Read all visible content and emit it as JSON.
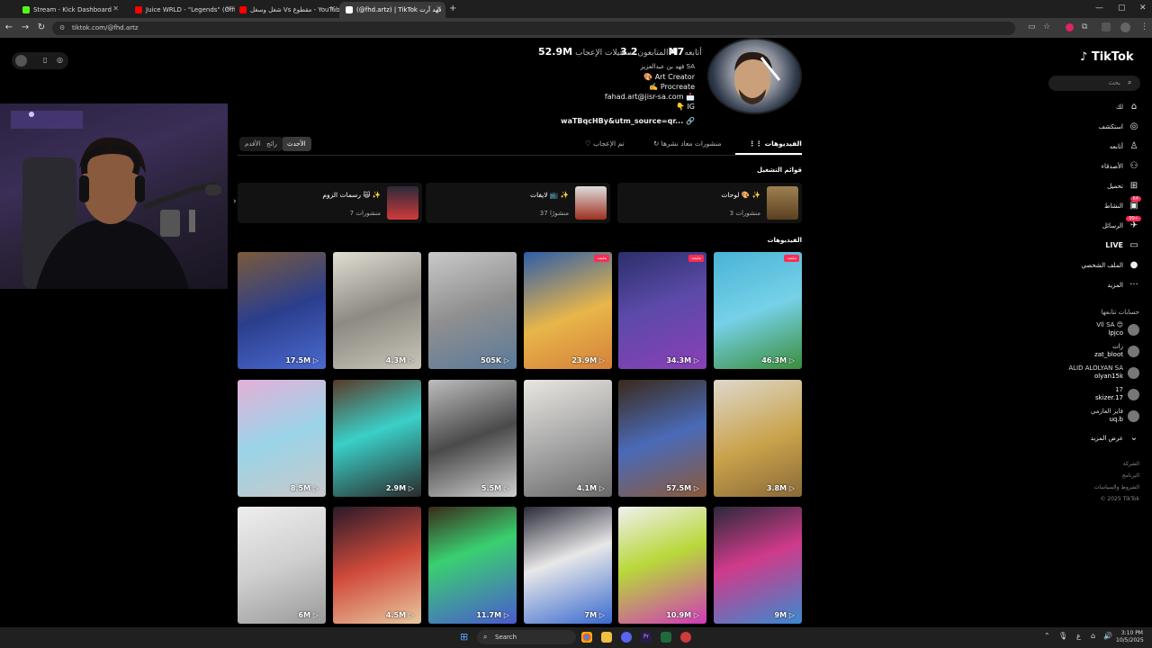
{
  "browser": {
    "tabs": [
      {
        "label": "Stream - Kick Dashboard",
        "color": "#53fc18"
      },
      {
        "label": "Juice WRLD - \"Legends\" (Offici...",
        "color": "#ff0000"
      },
      {
        "label": "شغل وسغل Vs مقطوع - YouTube",
        "color": "#ff0000"
      },
      {
        "label": "(@fhd.artz) | TikTok فهد آرت",
        "color": "#ffffff"
      }
    ],
    "url": "tiktok.com/@fhd.artz",
    "new_tab": "+"
  },
  "profile": {
    "stats": [
      {
        "label": "أتابعه",
        "value": "47"
      },
      {
        "label": "المتابعون",
        "value": "3.2M"
      },
      {
        "label": "تسجيلات الإعجاب",
        "value": "52.9M"
      }
    ],
    "bio": [
      "فهد بن عبدالعزيز SA",
      "🎨 Art Creator",
      "✍️ Procreate",
      "fahad.art@jisr-sa.com 📩",
      "👇 IG"
    ],
    "link": "waTBqcHBy&utm_source=qr..."
  },
  "sort": [
    {
      "label": "الأحدث",
      "active": true
    },
    {
      "label": "رائج",
      "active": false
    },
    {
      "label": "الأقدم",
      "active": false
    }
  ],
  "profile_tabs": [
    {
      "label": "الفيديوهات",
      "active": true
    },
    {
      "label": "منشورات معاد نشرها",
      "active": false
    },
    {
      "label": "تم الإعجاب",
      "active": false
    }
  ],
  "playlists_title": "قوائم التشغيل",
  "playlists": [
    {
      "title": "لوحات 🎨 ✨",
      "count": "3 منشورات"
    },
    {
      "title": "لايفات 📺 ✨",
      "count": "37 منشورًا"
    },
    {
      "title": "رسمات الزوم 🙀 ✨",
      "count": "7 منشورات"
    }
  ],
  "videos_title": "الفيديوهات",
  "pinned_label": "مثبت",
  "videos": [
    {
      "views": "46.3M",
      "pinned": true,
      "bg": "linear-gradient(160deg,#4ab3d6,#76d1e8 50%,#3a8e3a)"
    },
    {
      "views": "34.3M",
      "pinned": true,
      "bg": "linear-gradient(160deg,#2b2f6a,#5b4aa8 45%,#8a3fb8)"
    },
    {
      "views": "23.9M",
      "pinned": true,
      "bg": "linear-gradient(160deg,#2d5da8,#e8b64a 55%,#d4803a)"
    },
    {
      "views": "505K",
      "pinned": false,
      "bg": "linear-gradient(160deg,#c9c9c9,#8f8f8f 50%,#5a7a9a)"
    },
    {
      "views": "4.3M",
      "pinned": false,
      "bg": "linear-gradient(160deg,#e0ddd3,#8c8a82 50%,#c9c5b9)"
    },
    {
      "views": "17.5M",
      "pinned": false,
      "bg": "linear-gradient(160deg,#7a5a3a,#2b3e8c 50%,#4a6ad0)"
    },
    {
      "views": "3.8M",
      "pinned": false,
      "bg": "linear-gradient(160deg,#ddd8cc,#c9a24a 55%,#8a6a3a)"
    },
    {
      "views": "57.5M",
      "pinned": false,
      "bg": "linear-gradient(160deg,#3a2a1a,#4a6ab8 50%,#8a5a3a)"
    },
    {
      "views": "4.1M",
      "pinned": false,
      "bg": "linear-gradient(160deg,#e9e6e0,#aaa 50%,#6a6a6a)"
    },
    {
      "views": "5.5M",
      "pinned": false,
      "bg": "linear-gradient(160deg,#bdbdbd,#4a4a4a 50%,#cfcfcf)"
    },
    {
      "views": "2.9M",
      "pinned": false,
      "bg": "linear-gradient(160deg,#5a3a2a,#3ad0c8 45%,#2a2a2a)"
    },
    {
      "views": "8.5M",
      "pinned": false,
      "bg": "linear-gradient(160deg,#e4b0d8,#9ad4e8 50%,#c8c8c8)"
    },
    {
      "views": "9M",
      "pinned": false,
      "bg": "linear-gradient(160deg,#2a2a3a,#d03a8a 45%,#3a8ad0)"
    },
    {
      "views": "10.9M",
      "pinned": false,
      "bg": "linear-gradient(160deg,#f0f0f0,#b8d83a 45%,#d03ab8)"
    },
    {
      "views": "7M",
      "pinned": false,
      "bg": "linear-gradient(160deg,#2a2a3a,#e8e8e8 45%,#3a6ad0)"
    },
    {
      "views": "11.7M",
      "pinned": false,
      "bg": "linear-gradient(160deg,#3a2a1a,#3ad070 40%,#4a5ad0)"
    },
    {
      "views": "4.5M",
      "pinned": false,
      "bg": "linear-gradient(160deg,#2a1a2a,#d04a3a 50%,#e8c8a0)"
    },
    {
      "views": "6M",
      "pinned": false,
      "bg": "linear-gradient(160deg,#eeeeee,#cfcfcf 50%,#9a9a9a)"
    }
  ],
  "sidebar": {
    "logo": "TikTok",
    "search_placeholder": "بحث",
    "nav": [
      {
        "label": "لك",
        "icon": "home-icon",
        "glyph": "⌂"
      },
      {
        "label": "استكشف",
        "icon": "compass-icon",
        "glyph": "◎"
      },
      {
        "label": "أتابعه",
        "icon": "follow-icon",
        "glyph": "♙"
      },
      {
        "label": "الأصدقاء",
        "icon": "friends-icon",
        "glyph": "⚇"
      },
      {
        "label": "تحميل",
        "icon": "upload-icon",
        "glyph": "⊞"
      },
      {
        "label": "النشاط",
        "icon": "activity-icon",
        "glyph": "▣",
        "badge": "64"
      },
      {
        "label": "الرسائل",
        "icon": "messages-icon",
        "glyph": "✈",
        "badge": "99+"
      },
      {
        "label": "LIVE",
        "icon": "live-icon",
        "glyph": "▭"
      },
      {
        "label": "الملف الشخصي",
        "icon": "profile-icon",
        "glyph": "●"
      },
      {
        "label": "المزيد",
        "icon": "more-icon",
        "glyph": "···"
      }
    ],
    "following_title": "حسابات تتابعها",
    "following": [
      {
        "name": "Vll SA 😊",
        "handle": "lpjco"
      },
      {
        "name": "زات",
        "handle": "zat_bloot"
      },
      {
        "name": "ALID ALOLYAN SA",
        "handle": "olyan15k"
      },
      {
        "name": "17",
        "handle": "skizer.17"
      },
      {
        "name": "فايز العازمي",
        "handle": "uq.b"
      }
    ],
    "show_more": "عرض المزيد",
    "footer": [
      "الشركة",
      "البرنامج",
      "الشروط والسياسات",
      "© 2025 TikTok"
    ]
  },
  "taskbar": {
    "search": "Search",
    "time": "3:10 PM",
    "date": "10/5/2025"
  }
}
